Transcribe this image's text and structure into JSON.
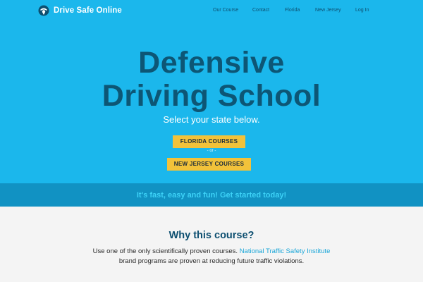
{
  "nav": {
    "brand": "Drive Safe Online",
    "logo_icon": "steering-helmet-icon",
    "links": [
      "Our Course",
      "Contact",
      "Florida",
      "New Jersey",
      "Log In"
    ]
  },
  "hero": {
    "headline_line1": "Defensive",
    "headline_line2": "Driving School",
    "tagline": "Select your state below.",
    "florida_button": "FLORIDA COURSES",
    "separator": "- or -",
    "nj_button": "NEW JERSEY COURSES"
  },
  "band": {
    "text": "It's fast, easy and fun! Get started today!"
  },
  "why": {
    "title": "Why this course?",
    "body_before": "Use one of the only scientifically proven courses.",
    "link": "National Traffic Safety Institute",
    "body_after": "brand programs are proven at reducing future traffic violations."
  },
  "colors": {
    "hero_bg": "#1bb7ec",
    "band_bg": "#1192c3",
    "band_text": "#3dd2f7",
    "headline": "#0d5675",
    "cta": "#f2c23a",
    "section_bg": "#f4f4f4"
  }
}
